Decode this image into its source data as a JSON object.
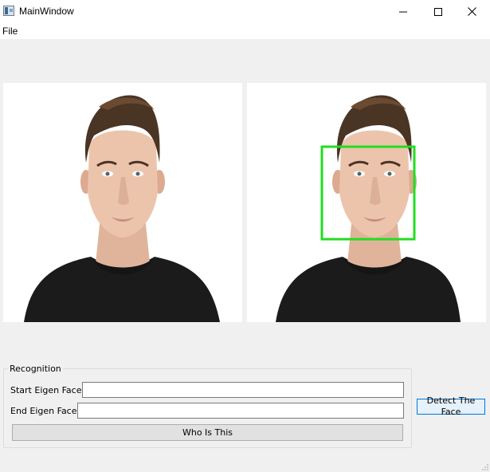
{
  "window": {
    "title": "MainWindow",
    "minimize_icon": "minimize-icon",
    "maximize_icon": "maximize-icon",
    "close_icon": "close-icon"
  },
  "menu": {
    "items": [
      {
        "label": "File"
      }
    ]
  },
  "images": {
    "original_alt": "",
    "detected_alt": "",
    "detection_box_color": "#22dd22"
  },
  "recognition": {
    "title": "Recognition",
    "start_label": "Start Eigen Face:",
    "start_value": "",
    "end_label": "End Eigen Face:",
    "end_value": "",
    "who_button": "Who Is This"
  },
  "actions": {
    "detect_button": "Detect The Face"
  }
}
